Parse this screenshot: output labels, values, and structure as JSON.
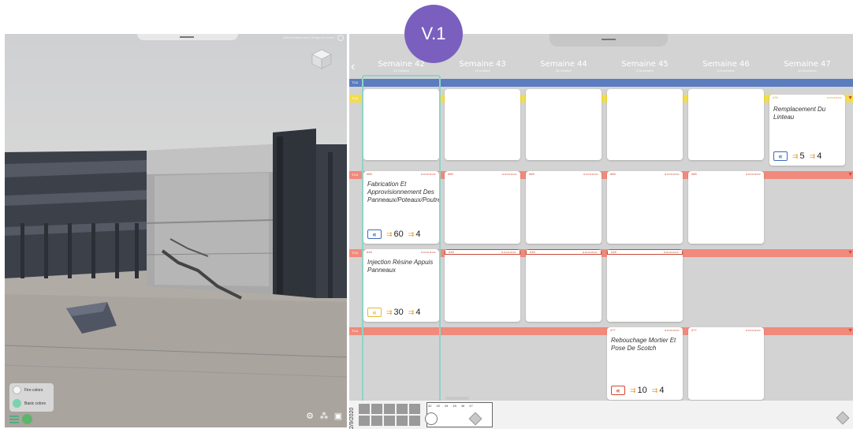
{
  "badge": {
    "label": "V.1"
  },
  "viewer": {
    "options_text": "Afficher détail selon l'étage du model",
    "legend": [
      {
        "label": "Fire colors",
        "color": "#f4f4f4"
      },
      {
        "label": "Basic colors",
        "color": "#7ad2b0"
      }
    ]
  },
  "planner": {
    "weeks": [
      {
        "label": "Semaine 42",
        "sub": "12 Octobre"
      },
      {
        "label": "Semaine 43",
        "sub": "19 Octobre"
      },
      {
        "label": "Semaine 44",
        "sub": "26 Octobre"
      },
      {
        "label": "Semaine 45",
        "sub": "2 Novembre"
      },
      {
        "label": "Semaine 46",
        "sub": "9 Novembre"
      },
      {
        "label": "Semaine 47",
        "sub": "16 Novembre"
      }
    ],
    "rows": [
      {
        "code": "TCA",
        "color": "#5b7dbf"
      },
      {
        "code": "TCA",
        "color": "#f2dd4a"
      },
      {
        "code": "TCA",
        "color": "#f08a7c"
      },
      {
        "code": "TCA",
        "color": "#f08a7c"
      },
      {
        "code": "TCA",
        "color": "#f08a7c"
      }
    ],
    "tasks": {
      "t_remplacement": {
        "tag": "#76",
        "dots": "ooooooo",
        "title": "Remplacement Du Linteau",
        "duration": "5",
        "workers": "4"
      },
      "t_fabrication": {
        "tag": "#65",
        "dots": "ooooooo",
        "title": "Fabrication Et Approvisionnement Des Panneaux/Poteaux/Poutres",
        "duration": "60",
        "workers": "4"
      },
      "t_injection": {
        "tag": "#16",
        "dots": "ooooooo",
        "title": "Injection Résine Appuis Panneaux",
        "duration": "30",
        "workers": "4"
      },
      "t_rebouchage": {
        "tag": "#77",
        "dots": "ooooooo",
        "title": "Rebouchage Mortier Et Pose De Scotch",
        "duration": "10",
        "workers": "4"
      }
    },
    "mini": {
      "tag65": "#65",
      "tag16": "#16",
      "tag77": "#77",
      "dots": "ooooooo"
    }
  },
  "timeline": {
    "date": "2/9/2020",
    "week_numbers": [
      "42",
      "43",
      "44",
      "45",
      "46",
      "47"
    ]
  },
  "colors": {
    "accent": "#7a5fbf",
    "current_week": "#8fd3c6",
    "red_band": "#f08a7c",
    "yellow_band": "#f2dd4a",
    "blue_band": "#5b7dbf"
  }
}
